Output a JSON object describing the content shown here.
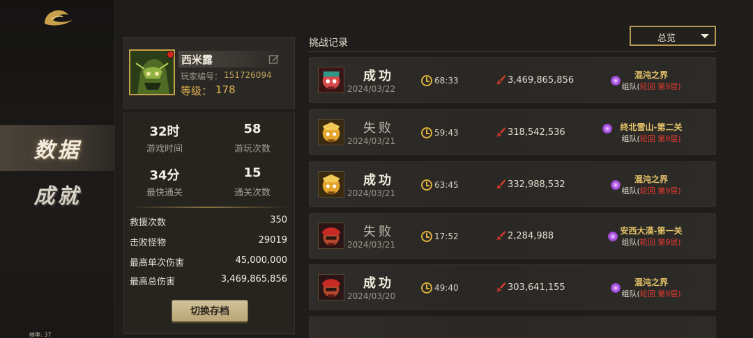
{
  "nav": {
    "items": [
      {
        "label": "数据"
      },
      {
        "label": "成就"
      }
    ],
    "fps": "帧率: 37"
  },
  "profile": {
    "name": "西米露",
    "id_label": "玩家编号：",
    "id": "151726094",
    "level_label": "等级：",
    "level": "178"
  },
  "stats": {
    "grid": [
      {
        "value": "32时",
        "label": "游戏时间"
      },
      {
        "value": "58",
        "label": "游玩次数"
      },
      {
        "value": "34分",
        "label": "最快通关"
      },
      {
        "value": "15",
        "label": "通关次数"
      }
    ],
    "details": [
      {
        "label": "救援次数",
        "value": "350"
      },
      {
        "label": "击败怪物",
        "value": "29019"
      },
      {
        "label": "最高单次伤害",
        "value": "45,000,000"
      },
      {
        "label": "最高总伤害",
        "value": "3,469,865,856"
      }
    ],
    "switch_button": "切换存档"
  },
  "records": {
    "title": "挑战记录",
    "filter": "总览",
    "rows": [
      {
        "result": "成功",
        "outcome": "win",
        "date": "2024/03/22",
        "time": "68:33",
        "damage": "3,469,865,856",
        "map": "混沌之界",
        "team": "组队(",
        "cycle": "轮回 第9层",
        "close": ")",
        "avatar": "red"
      },
      {
        "result": "失败",
        "outcome": "lose",
        "date": "2024/03/21",
        "time": "59:43",
        "damage": "318,542,536",
        "map": "终北雪山-第二关",
        "team": "组队(",
        "cycle": "轮回 第9层",
        "close": ")",
        "avatar": "gold"
      },
      {
        "result": "成功",
        "outcome": "win",
        "date": "2024/03/21",
        "time": "63:45",
        "damage": "332,988,532",
        "map": "混沌之界",
        "team": "组队(",
        "cycle": "轮回 第9层",
        "close": ")",
        "avatar": "gold"
      },
      {
        "result": "失败",
        "outcome": "lose",
        "date": "2024/03/21",
        "time": "17:52",
        "damage": "2,284,988",
        "map": "安西大漠-第一关",
        "team": "组队(",
        "cycle": "轮回 第9层",
        "close": ")",
        "avatar": "crimson"
      },
      {
        "result": "成功",
        "outcome": "win",
        "date": "2024/03/20",
        "time": "49:40",
        "damage": "303,641,155",
        "map": "混沌之界",
        "team": "组队(",
        "cycle": "轮回 第9层",
        "close": ")",
        "avatar": "crimson"
      }
    ]
  },
  "colors": {
    "accent_gold": "#e0b44f",
    "red_text": "#e43a31",
    "active_nav": "#4a4338"
  },
  "icons": [
    "logo-emblem",
    "edit-icon",
    "clock-icon",
    "sword-icon",
    "swirl-portal-icon",
    "chevron-down-icon"
  ]
}
